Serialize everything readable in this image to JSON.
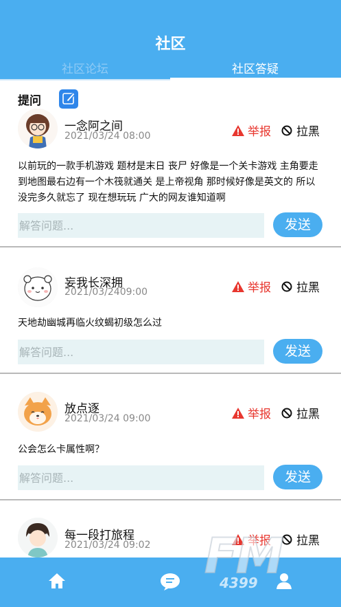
{
  "header": {
    "title": "社区",
    "tabs": [
      {
        "label": "社区论坛",
        "active": false
      },
      {
        "label": "社区答疑",
        "active": true
      }
    ]
  },
  "ask": {
    "label": "提问",
    "icon": "edit-icon"
  },
  "post_actions": {
    "report_label": "举报",
    "block_label": "拉黑",
    "answer_placeholder": "解答问题...",
    "send_label": "发送"
  },
  "posts": [
    {
      "username": "一念阿之间",
      "time": "2021/03/24 08:00",
      "content": "以前玩的一款手机游戏 题材是末日 丧尸 好像是一个关卡游戏 主角要走到地图最右边有一个木筏就通关 是上帝视角 那时候好像是英文的 所以没完多久就忘了 现在想玩玩 广大的网友谁知道啊",
      "avatar": "girl-avatar"
    },
    {
      "username": "妄我长深拥",
      "time": "2021/03/2409:00",
      "content": "天地劫幽城再临火纹蝎初级怎么过",
      "avatar": "bear-avatar"
    },
    {
      "username": "放点逐",
      "time": "2021/03/24 09:00",
      "content": "公会怎么卡属性啊？",
      "avatar": "shiba-avatar"
    },
    {
      "username": "每一段打旅程",
      "time": "2021/03/24 09:02",
      "content": "",
      "avatar": "boy-avatar"
    }
  ],
  "bottom_nav": {
    "items": [
      {
        "icon": "home-icon"
      },
      {
        "icon": "chat-icon"
      },
      {
        "icon": "user-icon"
      }
    ]
  },
  "watermark": {
    "brand": "FM",
    "number": "4399"
  },
  "colors": {
    "primary": "#4aaef0",
    "report": "#e8372f",
    "input_bg": "#e7f3f5"
  }
}
